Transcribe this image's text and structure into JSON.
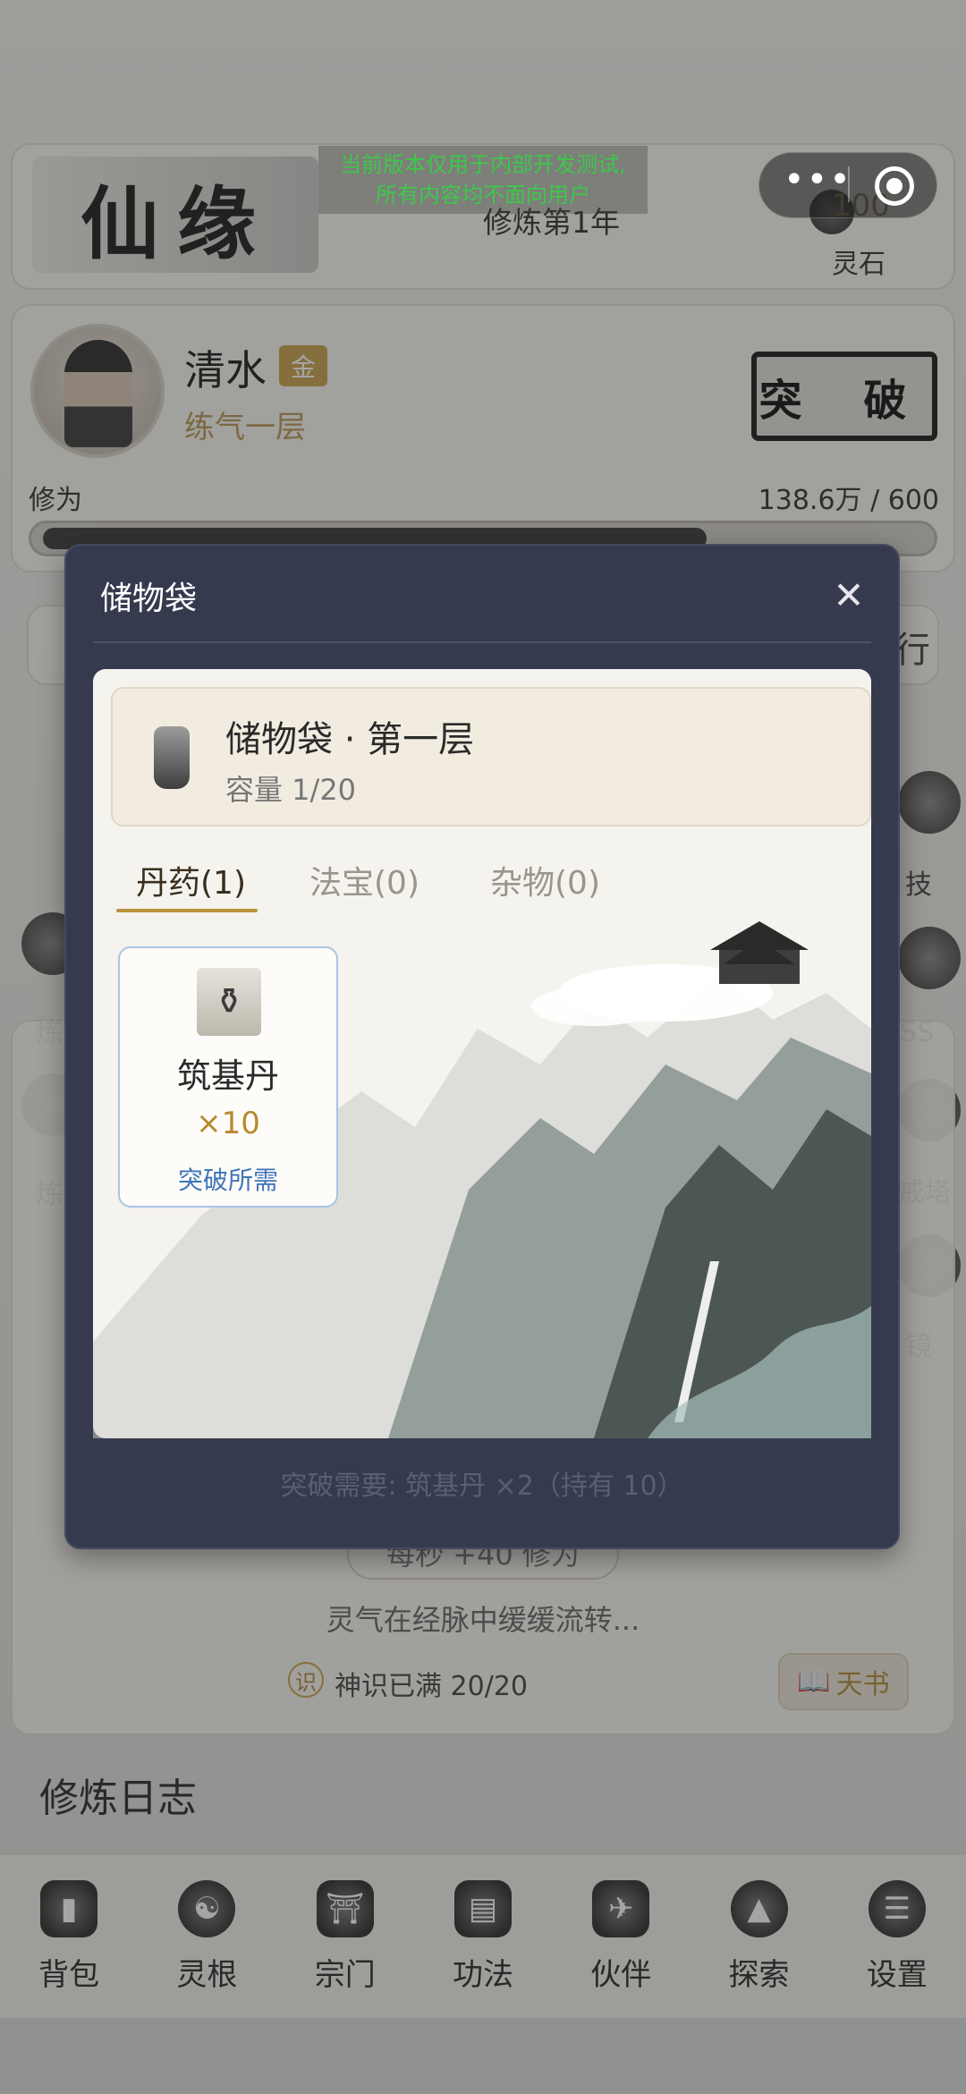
{
  "header": {
    "logo_text": "仙缘",
    "year_label": "修炼第1年",
    "stone_value": "100",
    "stone_label": "灵石"
  },
  "dev_notice": {
    "line1": "当前版本仅用于内部开发测试,",
    "line2": "所有内容均不面向用户"
  },
  "character": {
    "name": "清水",
    "badge": "金",
    "realm": "练气一层",
    "breakthrough_label": "突 破",
    "cultivation_label": "修为",
    "cultivation_value": "138.6万 / 600",
    "cultivation_progress": 0.73
  },
  "side_labels": {
    "left": [
      "炼",
      "炼"
    ],
    "right": [
      "技",
      "SS",
      "戒塔",
      "镜"
    ],
    "right_top": "行"
  },
  "status": {
    "rate": "每秒 +40 修为",
    "flow_text": "灵气在经脉中缓缓流转...",
    "sense_icon": "识",
    "sense_text": "神识已满 20/20",
    "book_label": "天书",
    "book_icon": "📖"
  },
  "log": {
    "title": "修炼日志"
  },
  "nav": [
    {
      "label": "背包",
      "icon": "bag-icon"
    },
    {
      "label": "灵根",
      "icon": "yin-yang-icon"
    },
    {
      "label": "宗门",
      "icon": "temple-icon"
    },
    {
      "label": "功法",
      "icon": "scroll-icon"
    },
    {
      "label": "伙伴",
      "icon": "crane-icon"
    },
    {
      "label": "探索",
      "icon": "mountain-icon"
    },
    {
      "label": "设置",
      "icon": "bagua-icon"
    }
  ],
  "capsule": {
    "more_icon": "•••"
  },
  "modal": {
    "title": "储物袋",
    "close_icon": "✕",
    "bag_title": "储物袋 · 第一层",
    "capacity": "容量 1/20",
    "tabs": [
      {
        "label": "丹药(1)",
        "active": true
      },
      {
        "label": "法宝(0)",
        "active": false
      },
      {
        "label": "杂物(0)",
        "active": false
      }
    ],
    "items": [
      {
        "name": "筑基丹",
        "count": "×10",
        "tag": "突破所需",
        "icon": "cauldron-icon"
      }
    ],
    "requirement": "突破需要: 筑基丹 ×2（持有 10）"
  }
}
